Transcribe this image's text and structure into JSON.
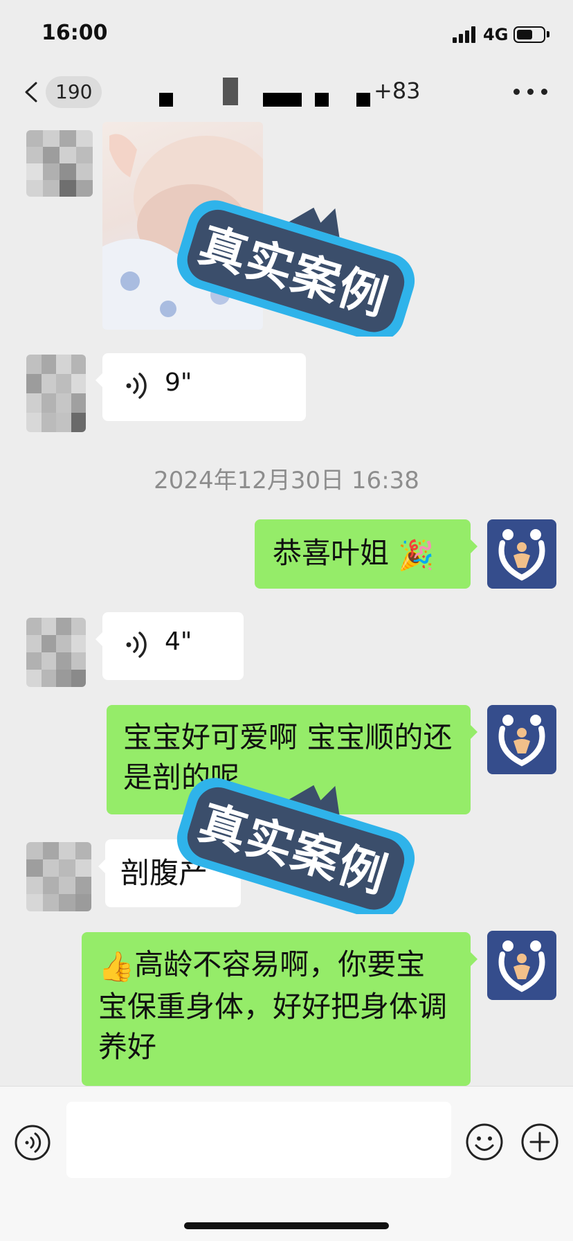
{
  "status_bar": {
    "time": "16:00",
    "network": "4G"
  },
  "nav": {
    "unread_count": "190",
    "title_visible_suffix": "+83",
    "more_icon": "ellipsis-icon"
  },
  "messages": {
    "voice1": {
      "duration": "9\""
    },
    "timestamp": "2024年12月30日 16:38",
    "msg_congrats": {
      "text": "恭喜叶姐",
      "emoji": "🎉"
    },
    "voice2": {
      "duration": "4\""
    },
    "msg_baby": {
      "text": "宝宝好可爱啊  宝宝顺的还是剖的呢"
    },
    "msg_csection": {
      "text": "剖腹产"
    },
    "msg_care": {
      "emoji": "👍",
      "text": "高龄不容易啊，你要宝宝保重身体，好好把身体调养好"
    }
  },
  "watermark": {
    "text": "真实案例"
  },
  "colors": {
    "self_bubble": "#95ec69",
    "other_bubble": "#ffffff",
    "brand_avatar": "#354d8c",
    "background": "#ededed"
  }
}
